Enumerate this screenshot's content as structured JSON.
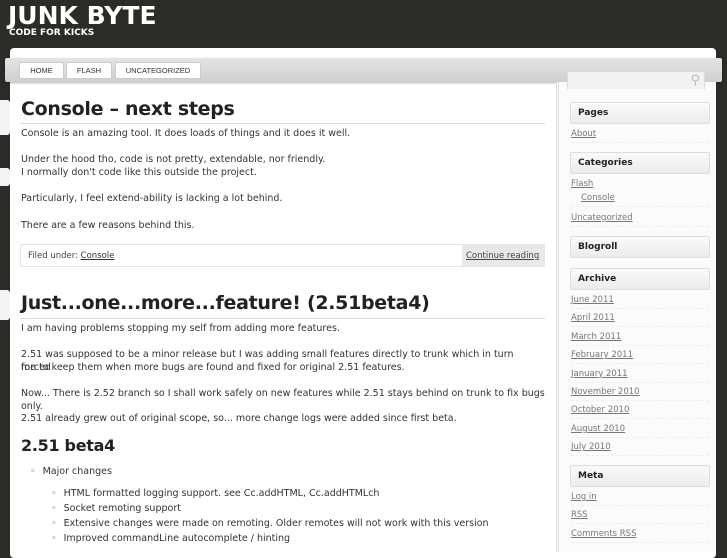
{
  "site": {
    "title": "JUNK BYTE",
    "tagline": "CODE FOR KICKS"
  },
  "nav": [
    "HOME",
    "FLASH",
    "UNCATEGORIZED"
  ],
  "search": {
    "placeholder": ""
  },
  "posts": [
    {
      "title": "Console – next steps",
      "paragraphs": [
        "Console is an amazing tool. It does loads of things and it does it well.",
        "Under the hood tho, code is not pretty, extendable, nor friendly.",
        "I normally don't code like this outside the project.",
        "Particularly, I feel extend-ability is lacking a lot behind.",
        "There are a few reasons behind this."
      ],
      "filed_label": "Filed under:",
      "category": "Console",
      "continue": "Continue reading"
    },
    {
      "title": "Just...one...more...feature! (2.51beta4)",
      "paragraphs": [
        "I am having problems stopping my self from adding more features.",
        "2.51 was supposed to be a minor release but I was adding small features directly to trunk which in turn forced",
        "me to keep them when more bugs are found and fixed for original 2.51 features.",
        "Now... There is 2.52 branch so I shall work safely on new features while 2.51 stays behind on trunk to fix bugs",
        "only.",
        "2.51 already grew out of original scope, so... more change logs were added since first beta."
      ],
      "subheading": "2.51 beta4",
      "list_top": "Major changes",
      "list": [
        "HTML formatted logging support. see Cc.addHTML, Cc.addHTMLch",
        "Socket remoting support",
        "Extensive changes were made on remoting. Older remotes will not work with this version",
        "Improved commandLine autocomplete / hinting"
      ]
    }
  ],
  "sidebar": {
    "pages": {
      "title": "Pages",
      "items": [
        "About"
      ]
    },
    "categories": {
      "title": "Categories",
      "items": [
        "Flash",
        "Console",
        "Uncategorized"
      ]
    },
    "blogroll": {
      "title": "Blogroll"
    },
    "archive": {
      "title": "Archive",
      "items": [
        "June 2011",
        "April 2011",
        "March 2011",
        "February 2011",
        "January 2011",
        "November 2010",
        "October 2010",
        "August 2010",
        "July 2010"
      ]
    },
    "meta": {
      "title": "Meta",
      "items": [
        "Log in",
        "RSS",
        "Comments RSS"
      ]
    }
  }
}
